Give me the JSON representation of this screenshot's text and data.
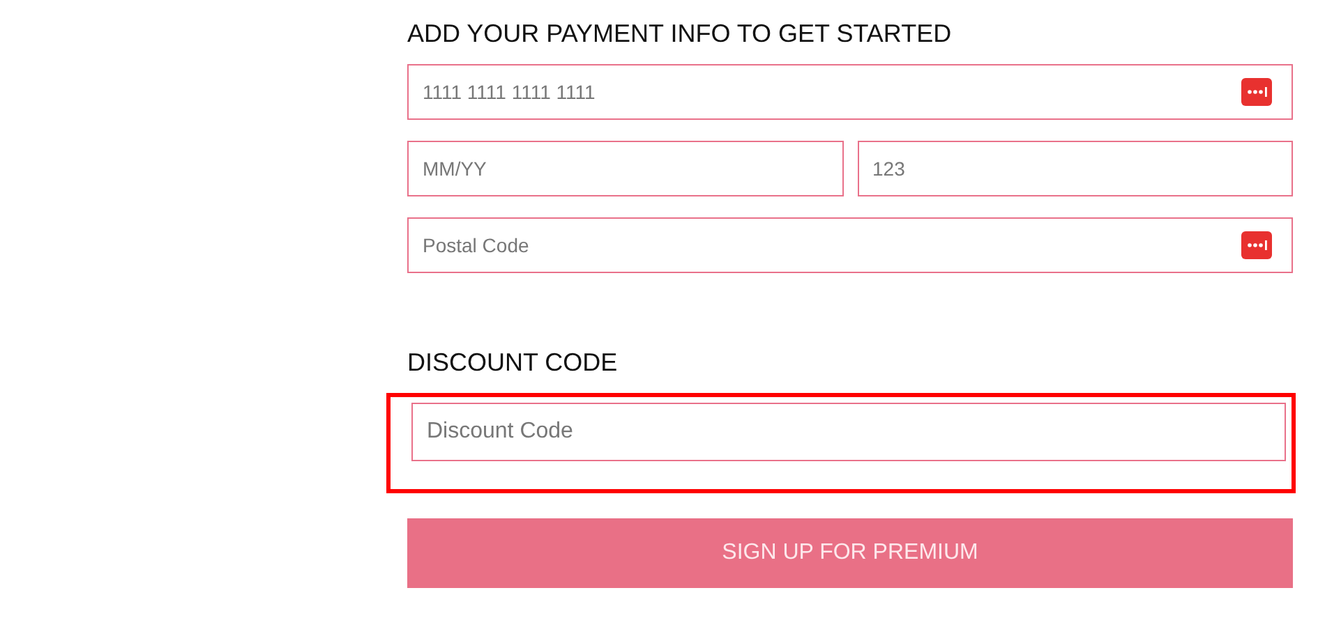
{
  "payment": {
    "heading": "ADD YOUR PAYMENT INFO TO GET STARTED",
    "fields": [
      {
        "placeholder": "1111 1111 1111 1111",
        "kind": "full",
        "autofill_icon": true
      },
      {
        "placeholder": "MM/YY",
        "kind": "half",
        "autofill_icon": false
      },
      {
        "placeholder": "123",
        "kind": "half",
        "autofill_icon": false
      },
      {
        "placeholder": "Postal Code",
        "kind": "full",
        "autofill_icon": true
      }
    ]
  },
  "discount": {
    "heading": "DISCOUNT CODE",
    "placeholder": "Discount Code",
    "highlighted": true
  },
  "submit_button": "SIGN UP FOR PREMIUM"
}
